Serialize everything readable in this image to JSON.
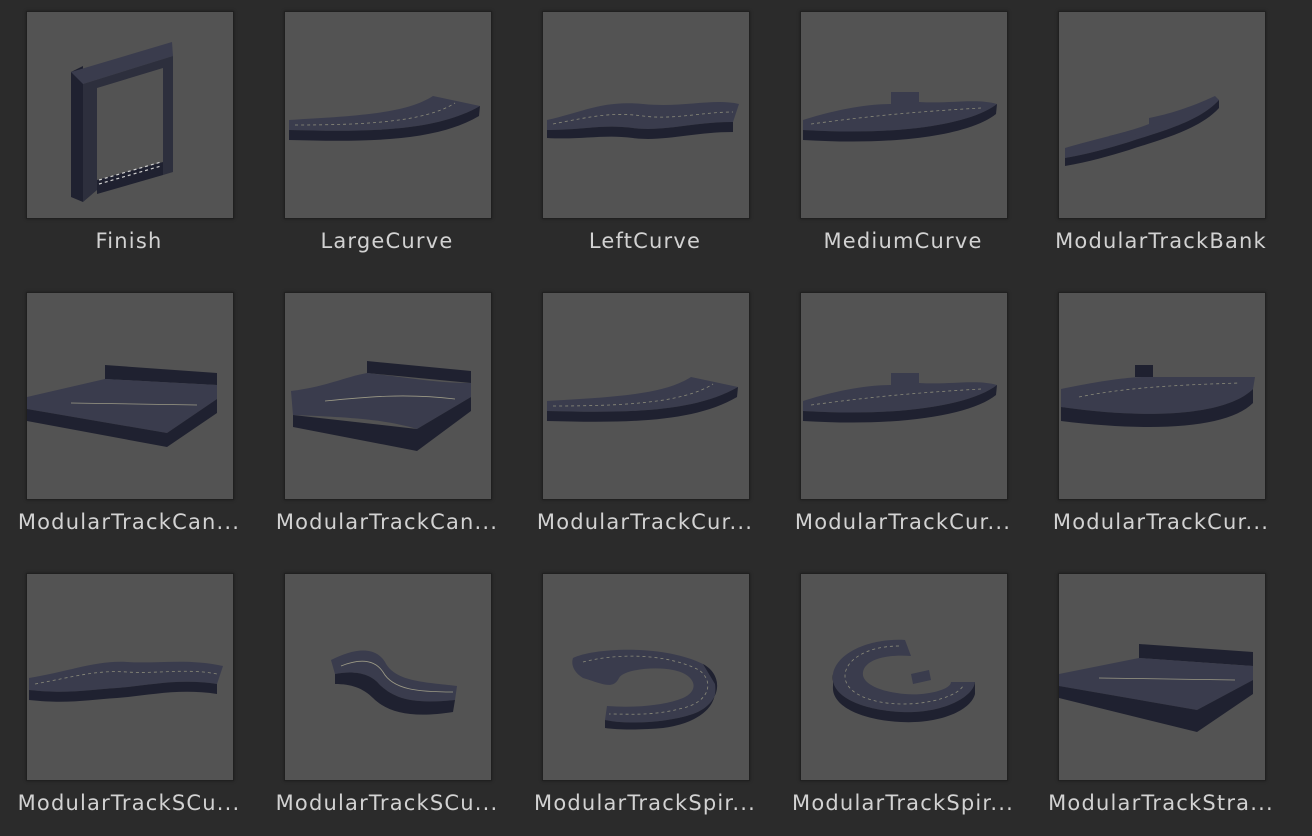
{
  "assets": [
    {
      "label": "Finish",
      "icon": "finish-gate-mesh"
    },
    {
      "label": "LargeCurve",
      "icon": "large-curve-mesh"
    },
    {
      "label": "LeftCurve",
      "icon": "left-curve-mesh"
    },
    {
      "label": "MediumCurve",
      "icon": "medium-curve-mesh"
    },
    {
      "label": "ModularTrackBank",
      "icon": "track-bank-mesh"
    },
    {
      "label": "ModularTrackCan...",
      "icon": "track-canyon-mesh"
    },
    {
      "label": "ModularTrackCan...",
      "icon": "track-canyon-mesh"
    },
    {
      "label": "ModularTrackCur...",
      "icon": "track-curve-mesh"
    },
    {
      "label": "ModularTrackCur...",
      "icon": "track-curve-mesh"
    },
    {
      "label": "ModularTrackCur...",
      "icon": "track-curve-mesh"
    },
    {
      "label": "ModularTrackSCu...",
      "icon": "track-s-curve-mesh"
    },
    {
      "label": "ModularTrackSCu...",
      "icon": "track-s-curve-mesh"
    },
    {
      "label": "ModularTrackSpir...",
      "icon": "track-spiral-mesh"
    },
    {
      "label": "ModularTrackSpir...",
      "icon": "track-spiral-mesh"
    },
    {
      "label": "ModularTrackStra...",
      "icon": "track-straight-mesh"
    }
  ]
}
